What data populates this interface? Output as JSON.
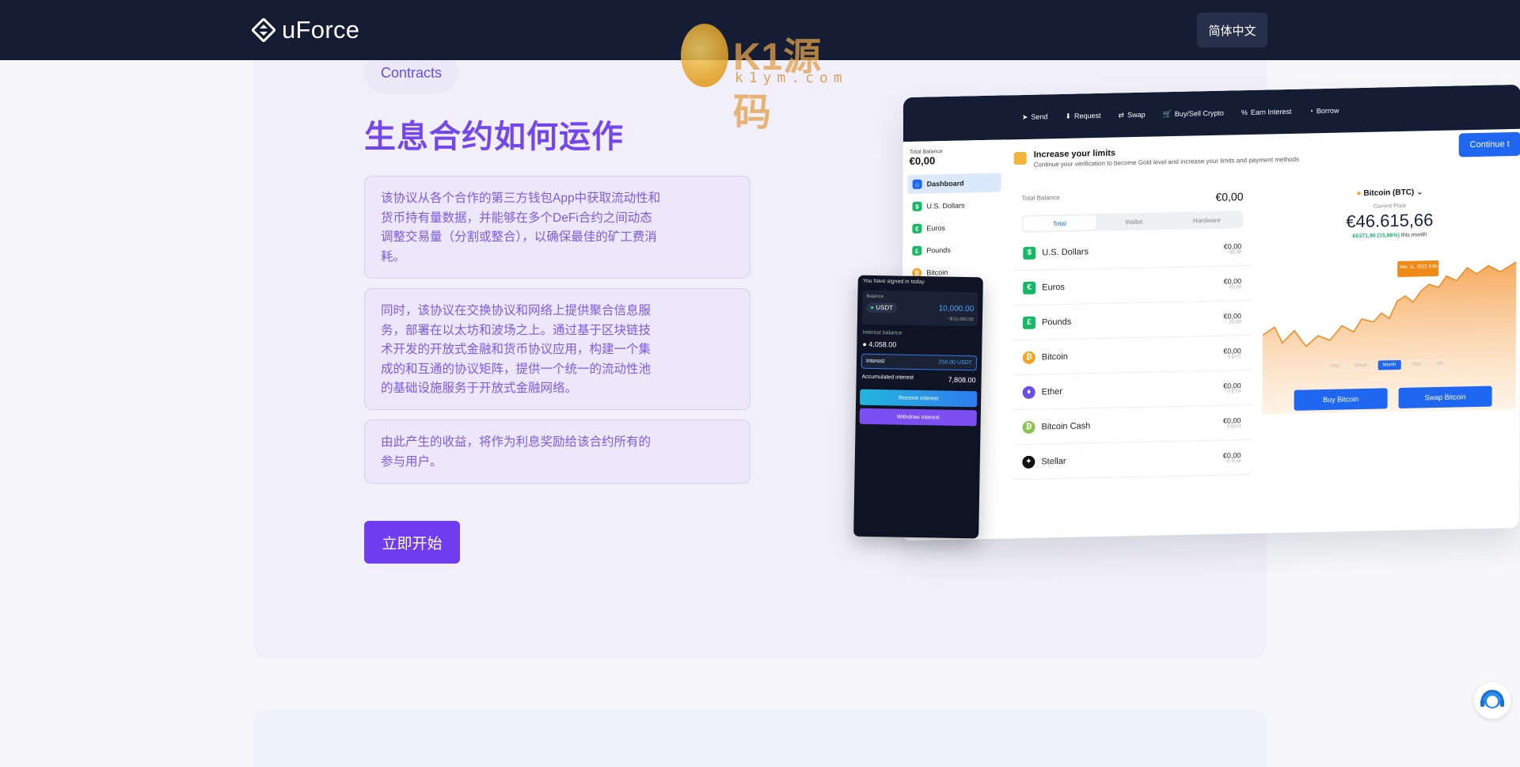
{
  "header": {
    "brand": "uForce",
    "language_button": "简体中文"
  },
  "watermark": {
    "title": "K1源码",
    "subtitle": "k1ym.com"
  },
  "section": {
    "pill_label": "Contracts",
    "heading": "生息合约如何运作",
    "paragraphs": [
      "该协议从各个合作的第三方钱包App中获取流动性和货币持有量数据，并能够在多个DeFi合约之间动态调整交易量（分割或整合），以确保最佳的矿工费消耗。",
      "同时，该协议在交换协议和网络上提供聚合信息服务，部署在以太坊和波场之上。通过基于区块链技术开发的开放式金融和货币协议应用，构建一个集成的和互通的协议矩阵，提供一个统一的流动性池的基础设施服务于开放式金融网络。",
      "由此产生的收益，将作为利息奖励给该合约所有的参与用户。"
    ],
    "cta": "立即开始"
  },
  "dashboard": {
    "top_actions": [
      "Send",
      "Request",
      "Swap",
      "Buy/Sell Crypto",
      "Earn Interest",
      "Borrow"
    ],
    "continue_label": "Continue t",
    "total_balance_label": "Total Balance",
    "total_balance_value": "€0,00",
    "nav": [
      {
        "label": "Dashboard",
        "icon": "home-icon",
        "color": "#1f67f0"
      },
      {
        "label": "U.S. Dollars",
        "icon": "dollar-icon",
        "color": "#19b868"
      },
      {
        "label": "Euros",
        "icon": "euro-icon",
        "color": "#19b868"
      },
      {
        "label": "Pounds",
        "icon": "pound-icon",
        "color": "#19b868"
      },
      {
        "label": "Bitcoin",
        "icon": "bitcoin-icon",
        "color": "#f4a424"
      }
    ],
    "limits_title": "Increase your limits",
    "limits_sub": "Continue your verification to become Gold level and increase your limits and payment methods",
    "balance_title": "Total Balance",
    "balance_value": "€0,00",
    "tabs": [
      "Total",
      "Wallet",
      "Hardware"
    ],
    "rows": [
      {
        "name": "U.S. Dollars",
        "amount": "€0,00",
        "sub": "$0,00",
        "glyph": "$",
        "color": "#19b868"
      },
      {
        "name": "Euros",
        "amount": "€0,00",
        "sub": "€0,00",
        "glyph": "€",
        "color": "#19b868"
      },
      {
        "name": "Pounds",
        "amount": "€0,00",
        "sub": "£0,00",
        "glyph": "£",
        "color": "#19b868"
      },
      {
        "name": "Bitcoin",
        "amount": "€0,00",
        "sub": "0 BTC",
        "glyph": "₿",
        "color": "#f4a424"
      },
      {
        "name": "Ether",
        "amount": "€0,00",
        "sub": "0 ETH",
        "glyph": "♦",
        "color": "#6a4fe0"
      },
      {
        "name": "Bitcoin Cash",
        "amount": "€0,00",
        "sub": "0 BCH",
        "glyph": "₿",
        "color": "#8dc351"
      },
      {
        "name": "Stellar",
        "amount": "€0,00",
        "sub": "0 XLM",
        "glyph": "✦",
        "color": "#111111"
      }
    ],
    "btc_title": "Bitcoin (BTC)",
    "btc_price_label": "Current Price",
    "btc_price": "€46.615,66",
    "btc_change": "€6371,90 (15,86%)",
    "btc_change_suffix": "this month",
    "btc_tooltip": "Mar 11, 2021 €48,445.47",
    "ranges": [
      "Day",
      "Week",
      "Month",
      "Year",
      "All"
    ],
    "buy_label": "Buy Bitcoin",
    "swap_label": "Swap Bitcoin"
  },
  "phone": {
    "signed": "You have signed in today",
    "balance_label": "Balance",
    "token": "USDT",
    "token_amount": "10,000.00",
    "token_sub": "~$10,000.00",
    "interest_label": "Interest balance",
    "interest_value": "4,058.00",
    "interest_row_label": "Interest",
    "interest_row_value": "250.00 USDT",
    "accum_label": "Accumulated interest",
    "accum_value": "7,808.00",
    "btn_receive": "Receive interest",
    "btn_withdraw": "Withdraw interest"
  }
}
